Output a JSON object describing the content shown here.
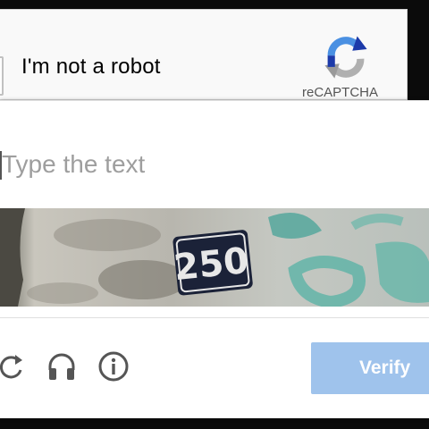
{
  "anchor": {
    "label": "I'm not a robot",
    "brand": "reCAPTCHA"
  },
  "challenge": {
    "input_placeholder": "Type the text",
    "input_value": "",
    "captcha_text": "250",
    "verify_label": "Verify"
  },
  "icons": {
    "reload": "reload-icon",
    "audio": "headphones-icon",
    "info": "info-icon",
    "logo": "recaptcha-logo-icon"
  },
  "colors": {
    "accent": "#4a90e2",
    "verify_bg": "#9fc3ec",
    "placeholder": "#9e9e9e",
    "logo_blue": "#1c3aa9",
    "logo_light_blue": "#4a90e2",
    "logo_gray": "#b0b0b0"
  }
}
